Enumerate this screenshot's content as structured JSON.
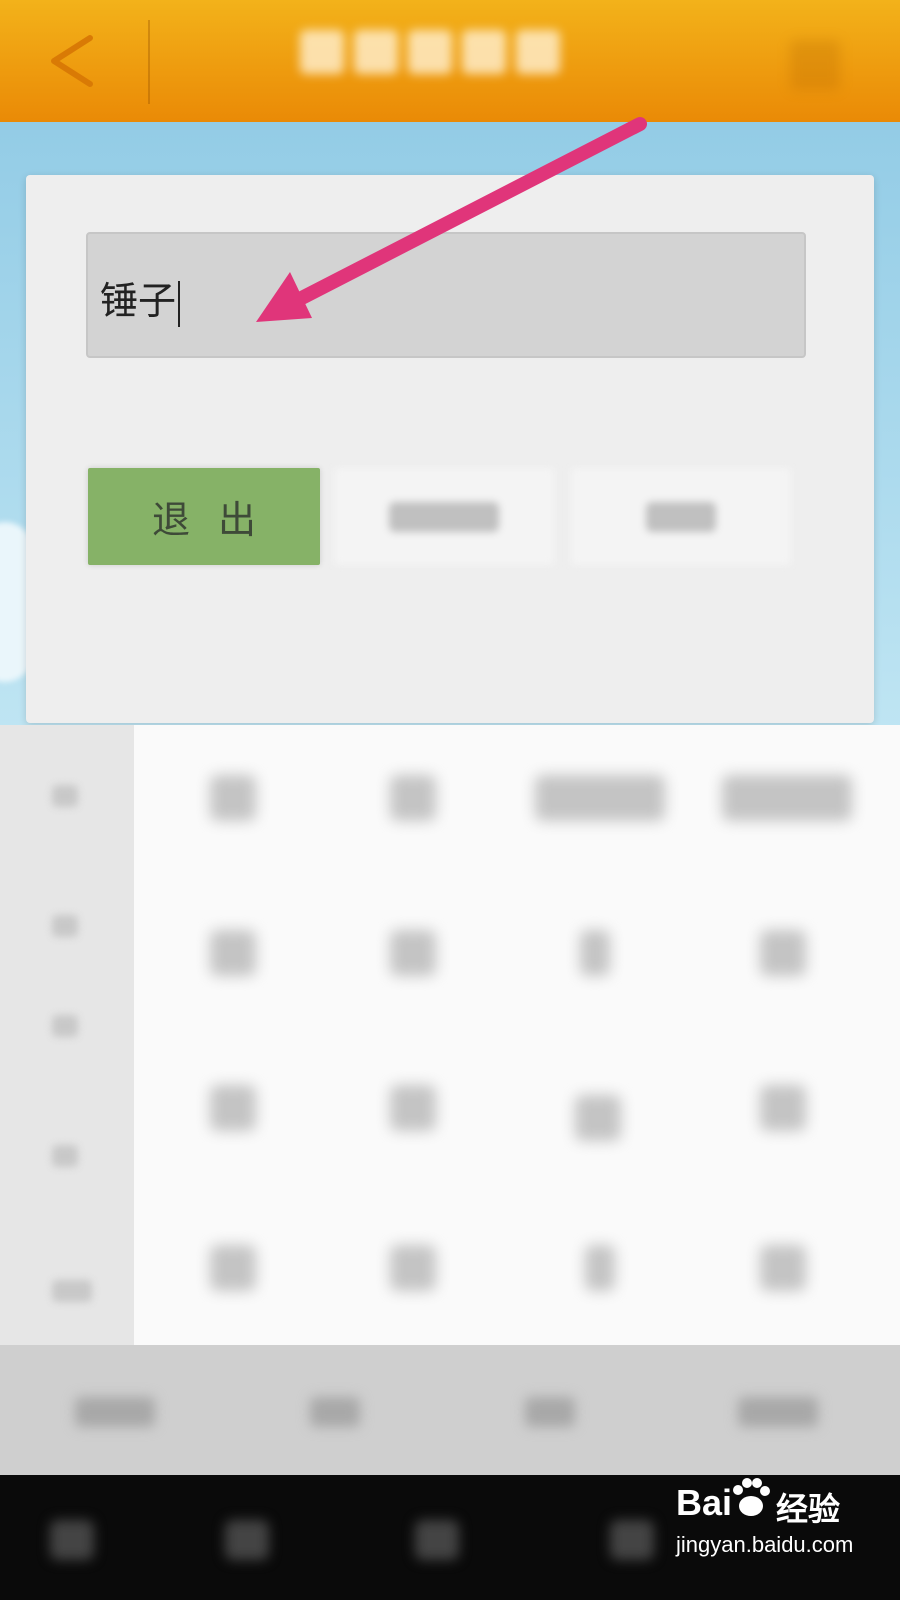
{
  "header": {
    "back_icon": "chevron-left-icon",
    "title": ""
  },
  "dialog": {
    "input_value": "锤子",
    "buttons": [
      {
        "label": "退出",
        "state": "active"
      },
      {
        "label": "",
        "state": "blurred"
      },
      {
        "label": "",
        "state": "blurred"
      }
    ]
  },
  "annotation": {
    "arrow_color": "#e0357a",
    "arrow_icon": "pointer-arrow"
  },
  "watermark": {
    "logo": "Bai",
    "brand_cn": "经验",
    "url": "jingyan.baidu.com"
  },
  "colors": {
    "header_top": "#f3b21a",
    "header_bottom": "#ea8a06",
    "exit_button": "#86b267"
  }
}
